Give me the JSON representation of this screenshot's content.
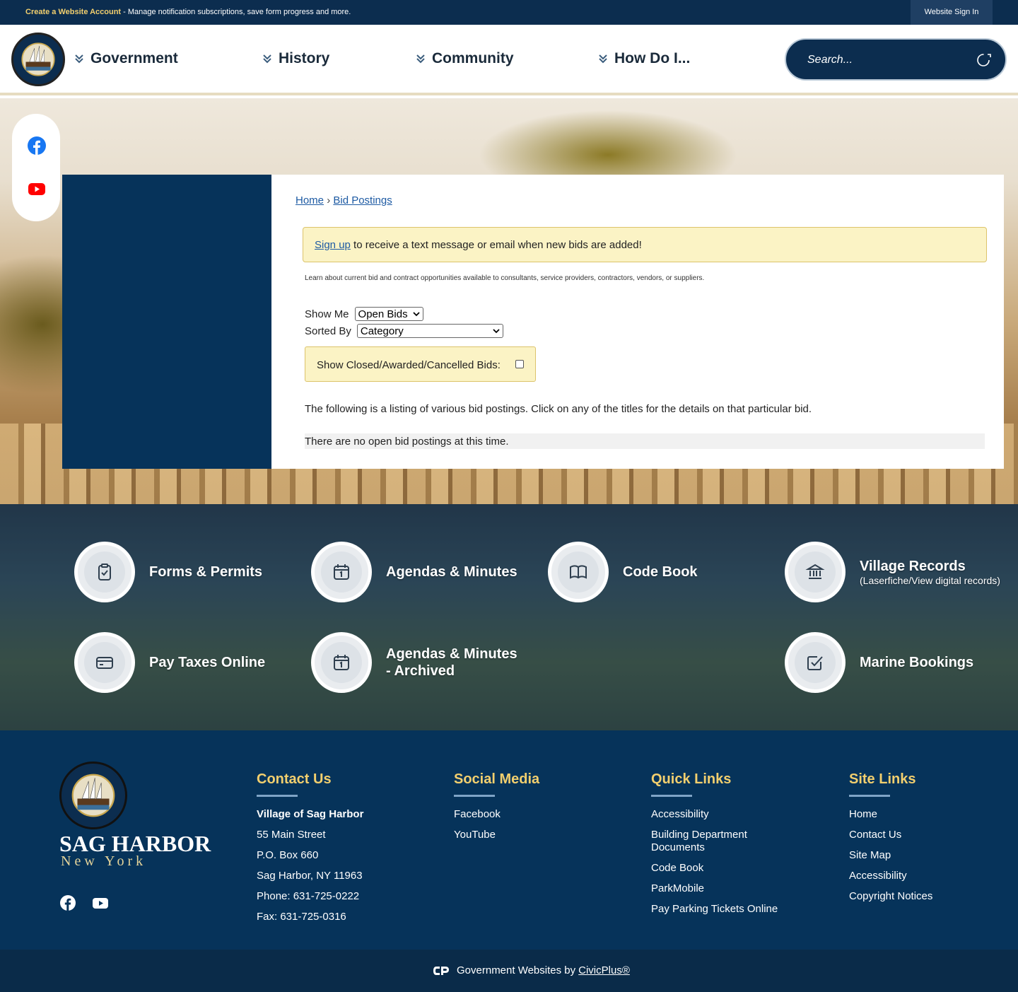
{
  "topbar": {
    "create_link": "Create a Website Account",
    "notice_rest": " - Manage notification subscriptions, save form progress and more.",
    "sign_in": "Website Sign In"
  },
  "header": {
    "nav": [
      "Government",
      "History",
      "Community",
      "How Do I..."
    ],
    "search_placeholder": "Search..."
  },
  "breadcrumb": {
    "home": "Home",
    "separator": "›",
    "current": "Bid Postings"
  },
  "alert": {
    "link": "Sign up",
    "rest": " to receive a text message or email when new bids are added!"
  },
  "learn_text": "Learn about current bid and contract opportunities available to consultants, service providers, contractors, vendors, or suppliers.",
  "filters": {
    "show_me_label": "Show Me",
    "show_me_value": "Open Bids",
    "sorted_by_label": "Sorted By",
    "sorted_by_value": "Category",
    "closed_label": "Show Closed/Awarded/Cancelled Bids:"
  },
  "listing_text": "The following is a listing of various bid postings. Click on any of the titles for the details on that particular bid.",
  "no_bids_text": "There are no open bid postings at this time.",
  "quick_links": [
    {
      "title": "Forms & Permits",
      "sub": "",
      "icon": "clipboard-icon"
    },
    {
      "title": "Agendas & Minutes",
      "sub": "",
      "icon": "calendar-icon"
    },
    {
      "title": "Code Book",
      "sub": "",
      "icon": "book-icon"
    },
    {
      "title": "Village Records",
      "sub": "(Laserfiche/View digital records)",
      "icon": "building-icon"
    },
    {
      "title": "Pay Taxes Online",
      "sub": "",
      "icon": "credit-card-icon"
    },
    {
      "title": "Agendas & Minutes - Archived",
      "sub": "",
      "icon": "calendar-icon"
    },
    {
      "title": "Marine Bookings",
      "sub": "",
      "icon": "checkbox-icon"
    }
  ],
  "footer": {
    "brand_name": "SAG HARBOR",
    "brand_sub": "New York",
    "logo_text": "SAG HARBOR · LONG ISLAND NY",
    "contact": {
      "heading": "Contact Us",
      "org": "Village of Sag Harbor",
      "lines": [
        "55 Main Street",
        "P.O. Box 660",
        "Sag Harbor, NY 11963",
        "Phone: 631-725-0222",
        "Fax: 631-725-0316"
      ]
    },
    "social": {
      "heading": "Social Media",
      "links": [
        "Facebook",
        "YouTube"
      ]
    },
    "quick": {
      "heading": "Quick Links",
      "links": [
        "Accessibility",
        "Building Department Documents",
        "Code Book",
        "ParkMobile",
        "Pay Parking Tickets Online"
      ]
    },
    "site": {
      "heading": "Site Links",
      "links": [
        "Home",
        "Contact Us",
        "Site Map",
        "Accessibility",
        "Copyright Notices"
      ]
    }
  },
  "bottom": {
    "prefix": "Government Websites by",
    "link": "CivicPlus®"
  },
  "colors": {
    "navy": "#0c2d4f",
    "sidebar": "#06335a",
    "gold": "#f2cf6e",
    "alert_bg": "#fbf3c5",
    "link": "#1d5aa3"
  }
}
